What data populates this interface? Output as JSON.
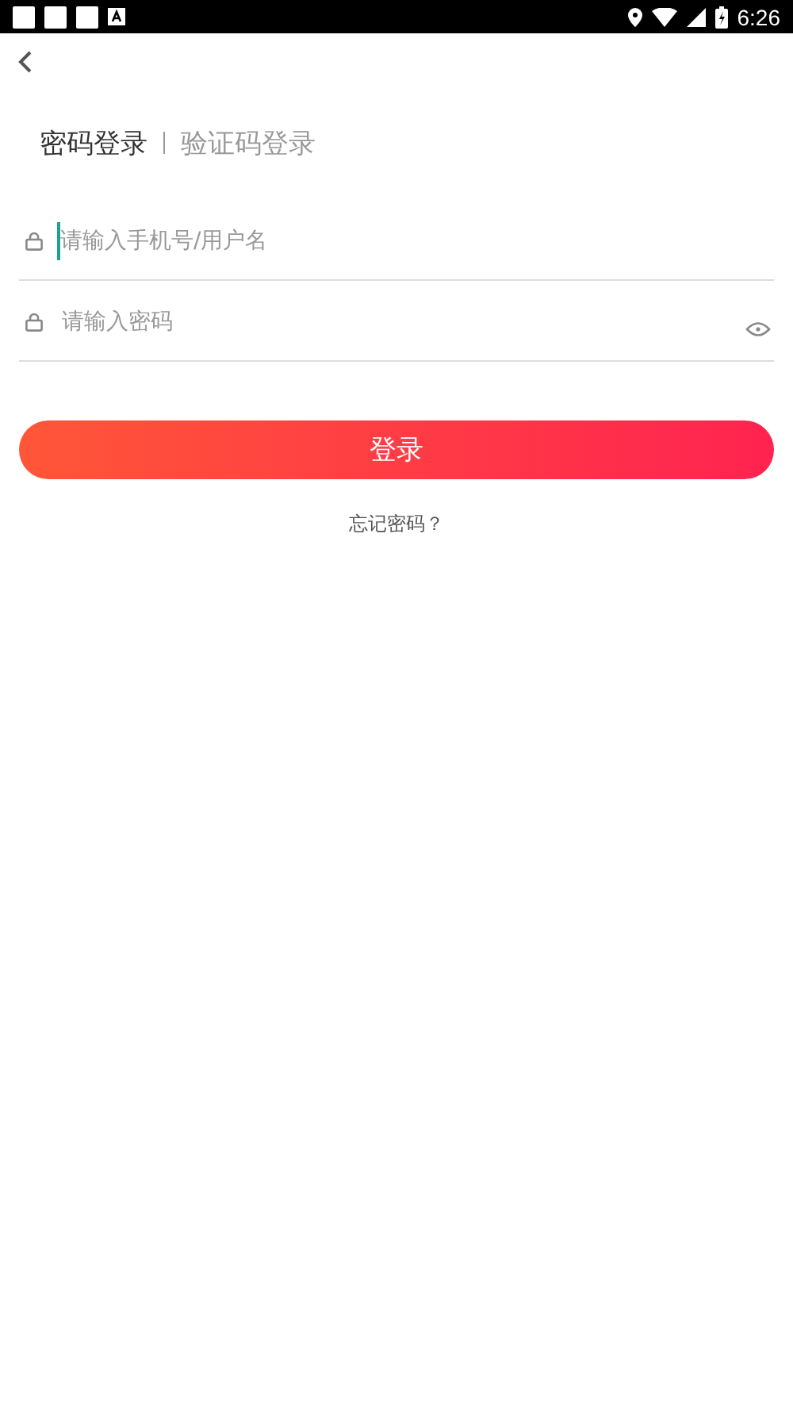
{
  "status_bar": {
    "time": "6:26"
  },
  "tabs": [
    {
      "label": "密码登录",
      "selected": true
    },
    {
      "label": "验证码登录",
      "selected": false
    }
  ],
  "fields": [
    {
      "kind": "account",
      "placeholder": "请输入手机号/用户名",
      "focused": true
    },
    {
      "kind": "password",
      "placeholder": "请输入密码",
      "focused": false
    }
  ],
  "login_button": {
    "label": "登录"
  },
  "forgot_link": {
    "label": "忘记密码？"
  }
}
